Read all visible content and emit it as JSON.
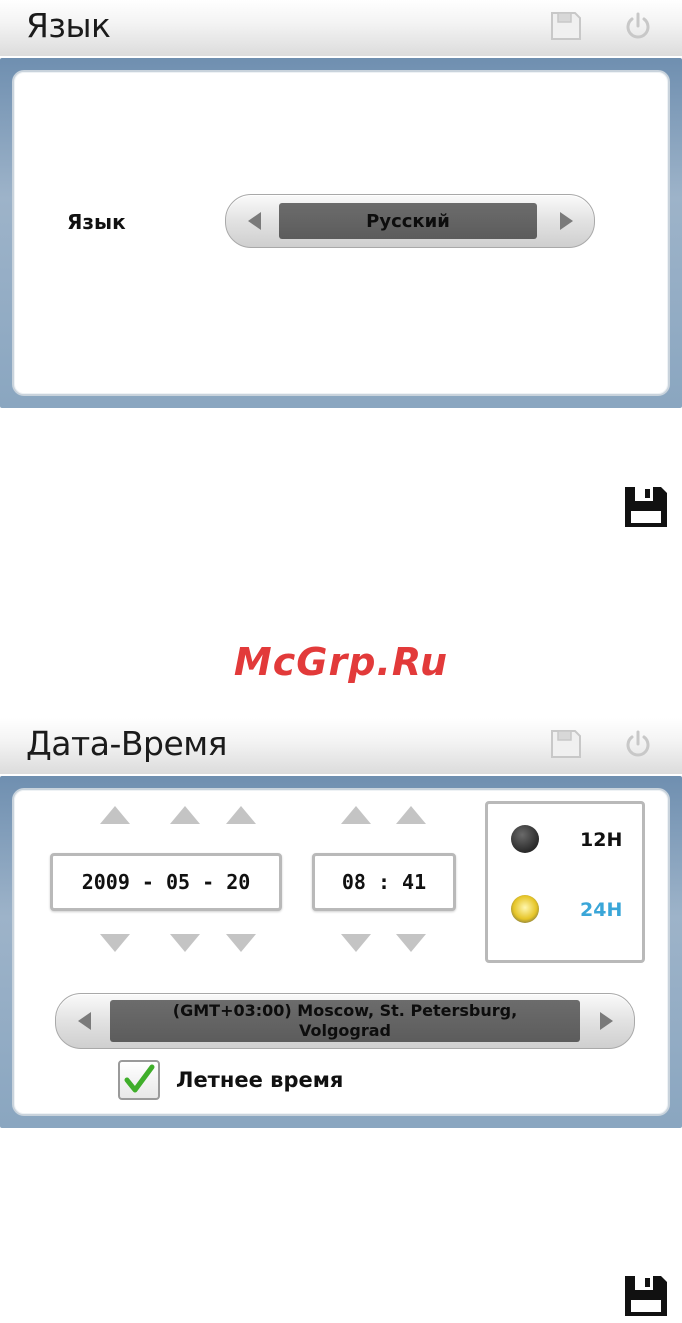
{
  "language_screen": {
    "title": "Язык",
    "field_label": "Язык",
    "selected_value": "Русский"
  },
  "datetime_screen": {
    "title": "Дата-Время",
    "date_text": "2009 - 05 - 20",
    "time_text": "08 : 41",
    "format_12": "12H",
    "format_24": "24H",
    "selected_format": "24H",
    "timezone_line1": "(GMT+03:00) Moscow, St. Petersburg,",
    "timezone_line2": "Volgograd",
    "dst_label": "Летнее время",
    "dst_checked": true
  },
  "watermark": "McGrp.Ru",
  "colors": {
    "panel_border": "#8aa6c0",
    "selected_format": "#3aa6d8",
    "checkmark": "#3fae2a",
    "watermark": "#e23a3a"
  }
}
